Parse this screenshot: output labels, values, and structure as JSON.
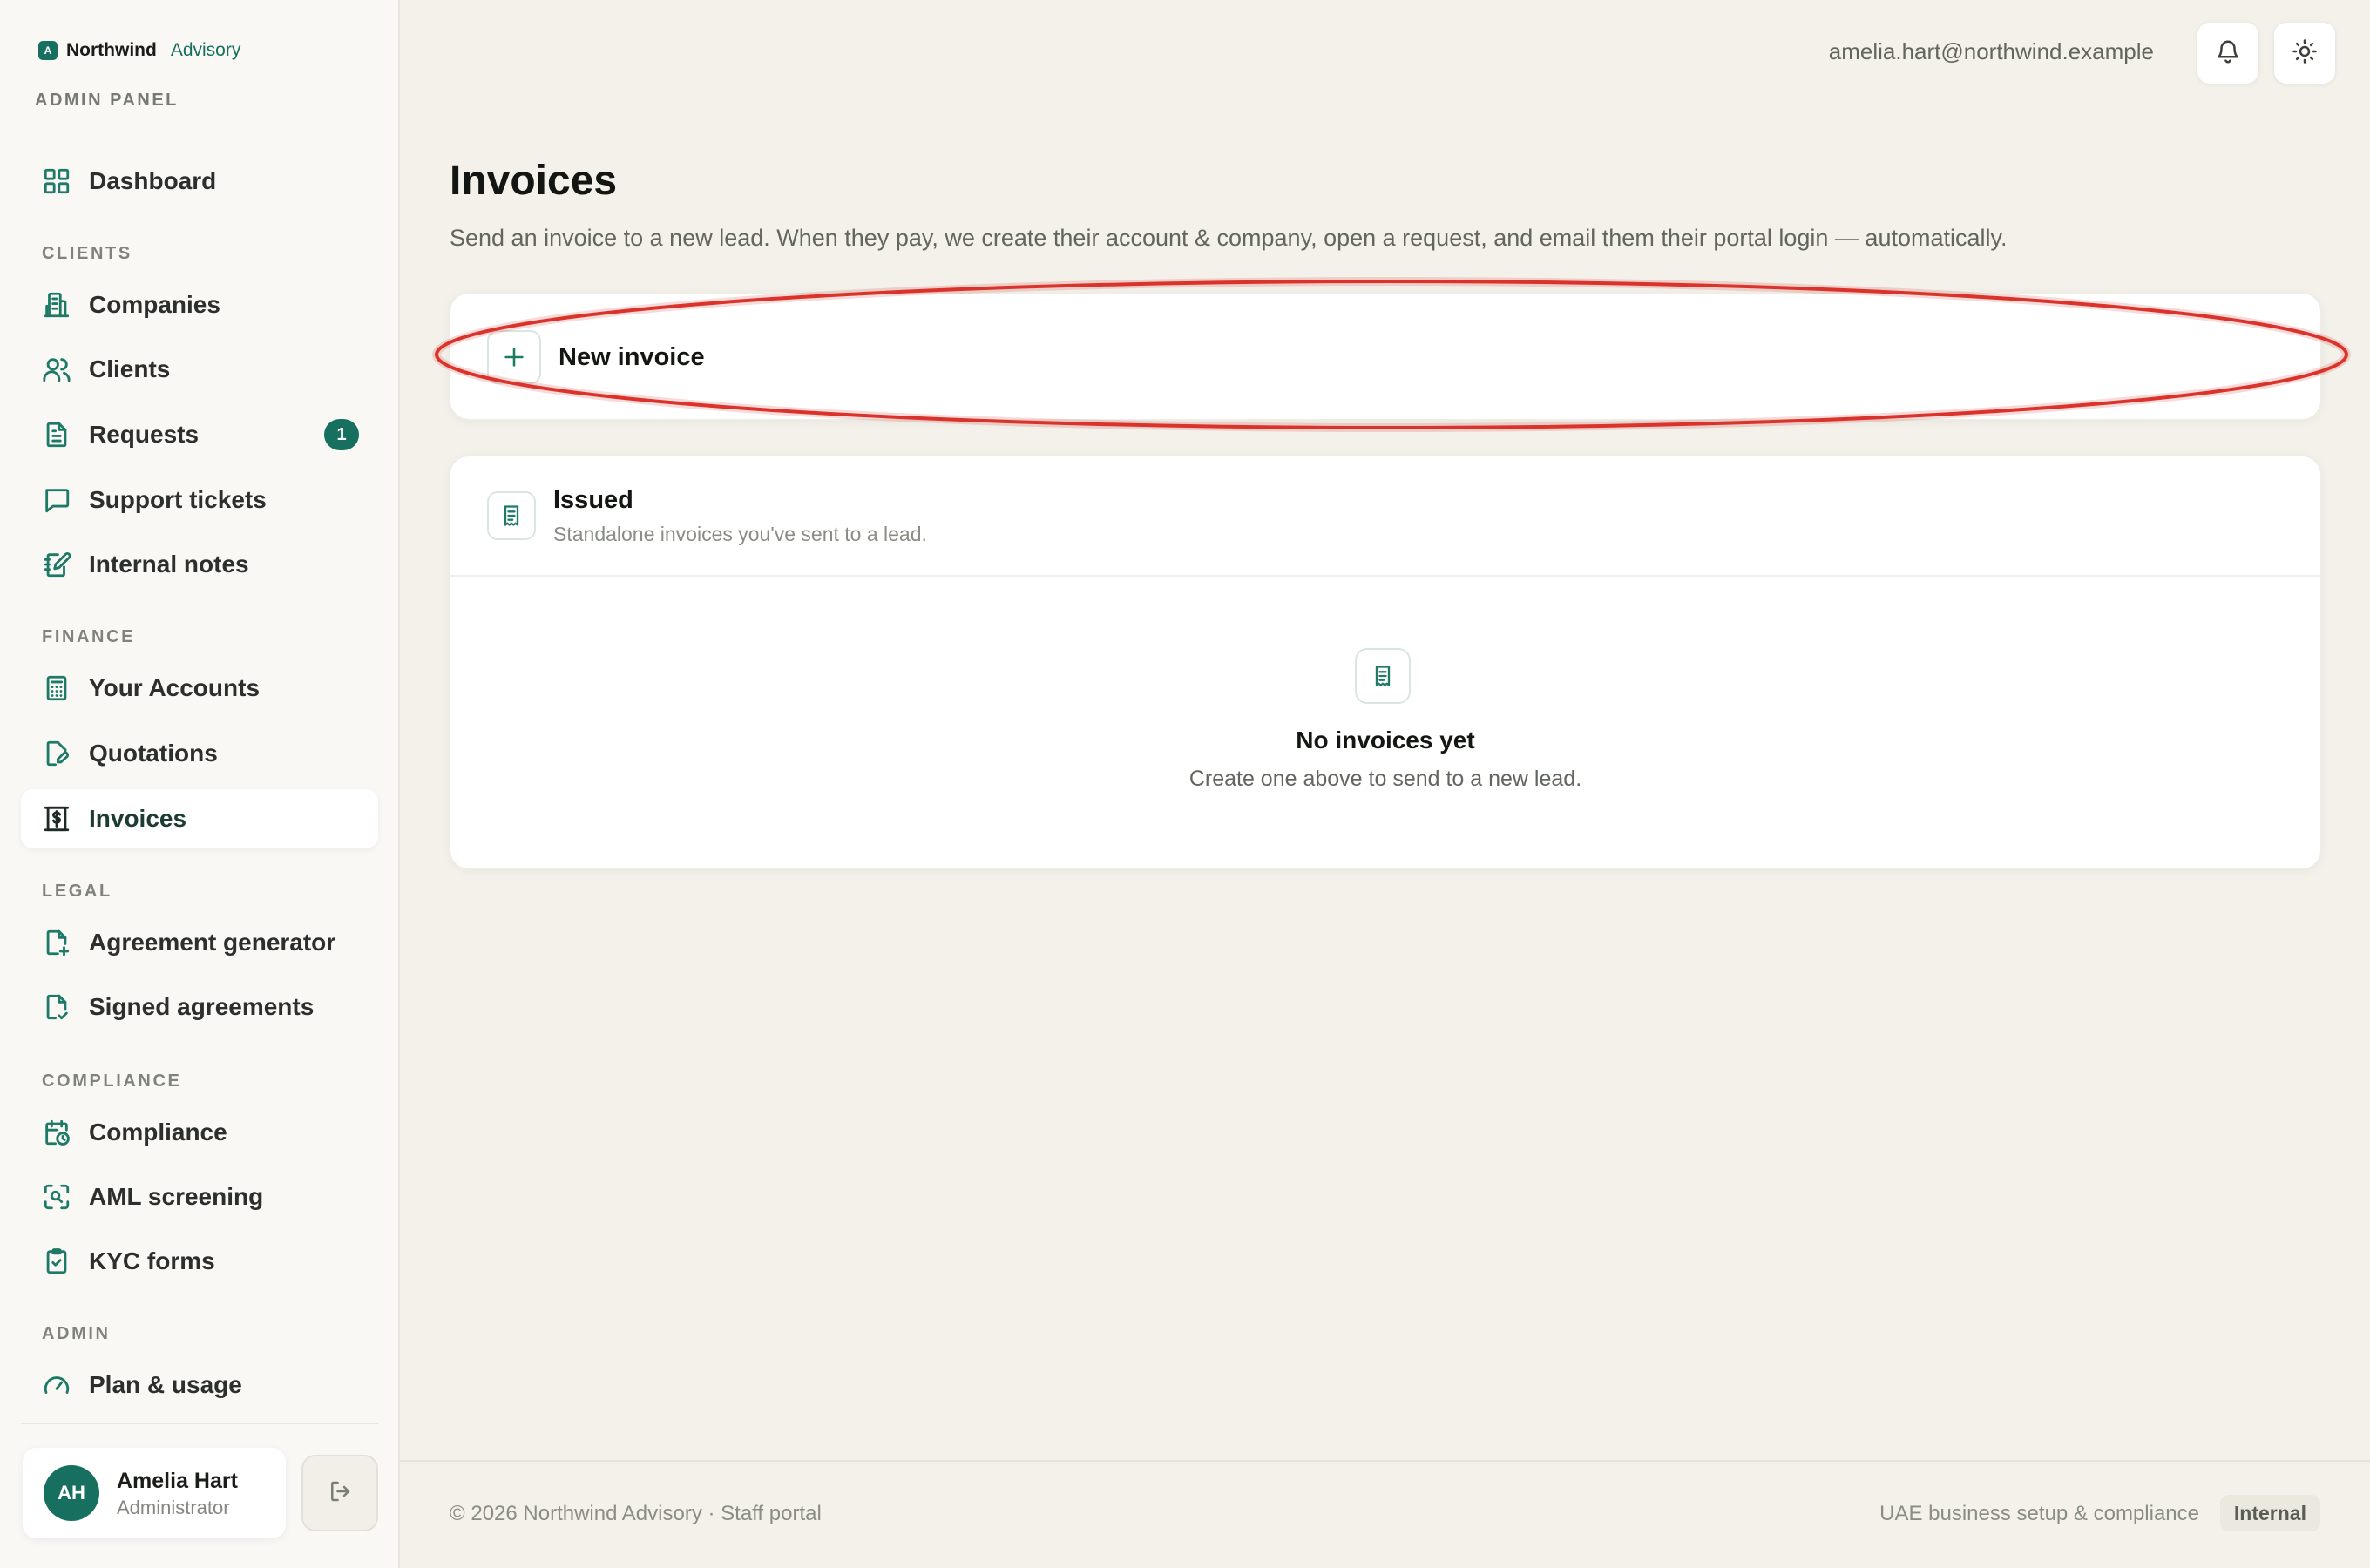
{
  "brand": {
    "mark": "A",
    "name": "Northwind",
    "sub": "Advisory",
    "panel_label": "ADMIN PANEL"
  },
  "sidebar": {
    "dashboard": {
      "label": "Dashboard",
      "icon": "grid-icon"
    },
    "sections": {
      "clients": "CLIENTS",
      "finance": "FINANCE",
      "legal": "LEGAL",
      "compliance": "COMPLIANCE",
      "admin": "ADMIN"
    },
    "items": {
      "companies": {
        "label": "Companies",
        "icon": "building-icon"
      },
      "clients": {
        "label": "Clients",
        "icon": "users-icon"
      },
      "requests": {
        "label": "Requests",
        "icon": "document-icon",
        "badge": "1"
      },
      "support_tickets": {
        "label": "Support tickets",
        "icon": "chat-icon"
      },
      "internal_notes": {
        "label": "Internal notes",
        "icon": "notes-icon"
      },
      "your_accounts": {
        "label": "Your Accounts",
        "icon": "calculator-icon"
      },
      "quotations": {
        "label": "Quotations",
        "icon": "file-edit-icon"
      },
      "invoices": {
        "label": "Invoices",
        "icon": "invoice-dollar-icon",
        "active": true
      },
      "agreement_generator": {
        "label": "Agreement generator",
        "icon": "file-plus-icon"
      },
      "signed_agreements": {
        "label": "Signed agreements",
        "icon": "file-check-icon"
      },
      "compliance": {
        "label": "Compliance",
        "icon": "calendar-clock-icon"
      },
      "aml_screening": {
        "label": "AML screening",
        "icon": "scan-search-icon"
      },
      "kyc_forms": {
        "label": "KYC forms",
        "icon": "clipboard-check-icon"
      },
      "plan_usage": {
        "label": "Plan & usage",
        "icon": "gauge-icon"
      }
    },
    "user": {
      "initials": "AH",
      "name": "Amelia Hart",
      "role": "Administrator"
    }
  },
  "topbar": {
    "email": "amelia.hart@northwind.example"
  },
  "page": {
    "title": "Invoices",
    "description": "Send an invoice to a new lead. When they pay, we create their account & company, open a request, and email them their portal login — automatically."
  },
  "new_invoice": {
    "label": "New invoice"
  },
  "issued": {
    "title": "Issued",
    "subtitle": "Standalone invoices you've sent to a lead.",
    "empty_title": "No invoices yet",
    "empty_subtitle": "Create one above to send to a new lead."
  },
  "footer": {
    "left": "© 2026 Northwind Advisory · Staff portal",
    "right": "UAE business setup & compliance",
    "tag": "Internal"
  },
  "colors": {
    "accent": "#17705f",
    "highlight": "#d9332b"
  }
}
